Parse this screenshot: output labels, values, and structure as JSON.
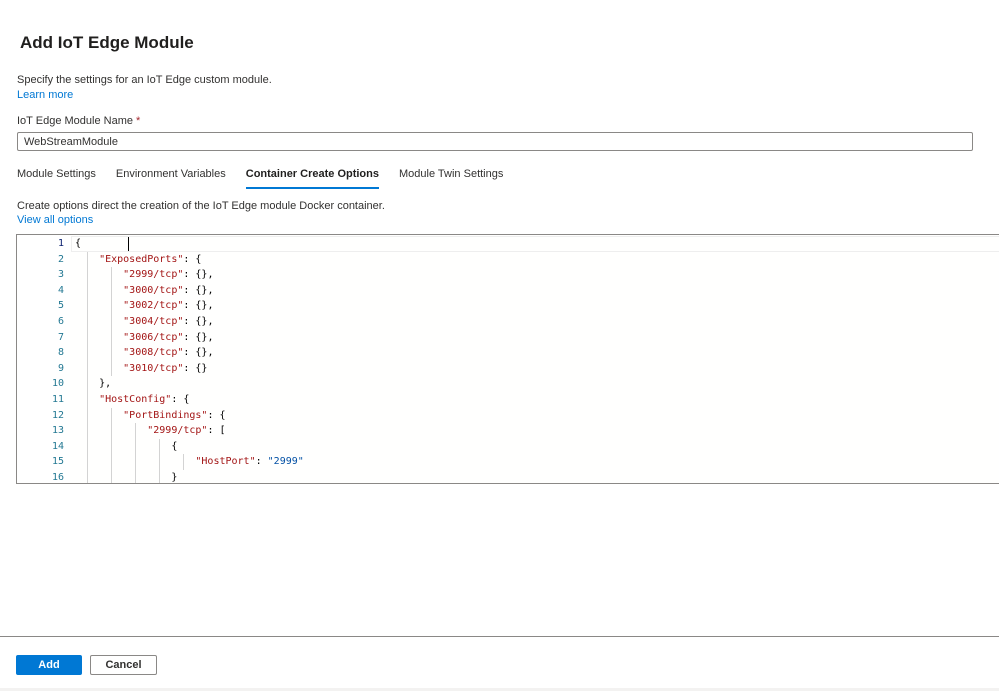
{
  "page": {
    "title": "Add IoT Edge Module",
    "description": "Specify the settings for an IoT Edge custom module.",
    "learn_more": "Learn more"
  },
  "module_name": {
    "label": "IoT Edge Module Name",
    "required_mark": "*",
    "value": "WebStreamModule"
  },
  "tabs": [
    {
      "label": "Module Settings",
      "active": false
    },
    {
      "label": "Environment Variables",
      "active": false
    },
    {
      "label": "Container Create Options",
      "active": true
    },
    {
      "label": "Module Twin Settings",
      "active": false
    }
  ],
  "container_options": {
    "description": "Create options direct the creation of the IoT Edge module Docker container.",
    "view_all": "View all options"
  },
  "editor": {
    "lines": [
      {
        "n": "1",
        "indent": 0,
        "parts": [
          [
            "p",
            "{"
          ]
        ]
      },
      {
        "n": "2",
        "indent": 1,
        "parts": [
          [
            "k",
            "\"ExposedPorts\""
          ],
          [
            "p",
            ": {"
          ]
        ]
      },
      {
        "n": "3",
        "indent": 2,
        "parts": [
          [
            "k",
            "\"2999/tcp\""
          ],
          [
            "p",
            ": {},"
          ]
        ]
      },
      {
        "n": "4",
        "indent": 2,
        "parts": [
          [
            "k",
            "\"3000/tcp\""
          ],
          [
            "p",
            ": {},"
          ]
        ]
      },
      {
        "n": "5",
        "indent": 2,
        "parts": [
          [
            "k",
            "\"3002/tcp\""
          ],
          [
            "p",
            ": {},"
          ]
        ]
      },
      {
        "n": "6",
        "indent": 2,
        "parts": [
          [
            "k",
            "\"3004/tcp\""
          ],
          [
            "p",
            ": {},"
          ]
        ]
      },
      {
        "n": "7",
        "indent": 2,
        "parts": [
          [
            "k",
            "\"3006/tcp\""
          ],
          [
            "p",
            ": {},"
          ]
        ]
      },
      {
        "n": "8",
        "indent": 2,
        "parts": [
          [
            "k",
            "\"3008/tcp\""
          ],
          [
            "p",
            ": {},"
          ]
        ]
      },
      {
        "n": "9",
        "indent": 2,
        "parts": [
          [
            "k",
            "\"3010/tcp\""
          ],
          [
            "p",
            ": {}"
          ]
        ]
      },
      {
        "n": "10",
        "indent": 1,
        "parts": [
          [
            "p",
            "},"
          ]
        ]
      },
      {
        "n": "11",
        "indent": 1,
        "parts": [
          [
            "k",
            "\"HostConfig\""
          ],
          [
            "p",
            ": {"
          ]
        ]
      },
      {
        "n": "12",
        "indent": 2,
        "parts": [
          [
            "k",
            "\"PortBindings\""
          ],
          [
            "p",
            ": {"
          ]
        ]
      },
      {
        "n": "13",
        "indent": 3,
        "parts": [
          [
            "k",
            "\"2999/tcp\""
          ],
          [
            "p",
            ": ["
          ]
        ]
      },
      {
        "n": "14",
        "indent": 4,
        "parts": [
          [
            "p",
            "{"
          ]
        ]
      },
      {
        "n": "15",
        "indent": 5,
        "parts": [
          [
            "k",
            "\"HostPort\""
          ],
          [
            "p",
            ": "
          ],
          [
            "s",
            "\"2999\""
          ]
        ]
      },
      {
        "n": "16",
        "indent": 4,
        "parts": [
          [
            "p",
            "}"
          ]
        ]
      }
    ]
  },
  "footer": {
    "add_label": "Add",
    "cancel_label": "Cancel"
  },
  "colors": {
    "accent": "#0078d4",
    "json_key": "#a31515",
    "json_string": "#0451a5",
    "line_number": "#237893"
  }
}
